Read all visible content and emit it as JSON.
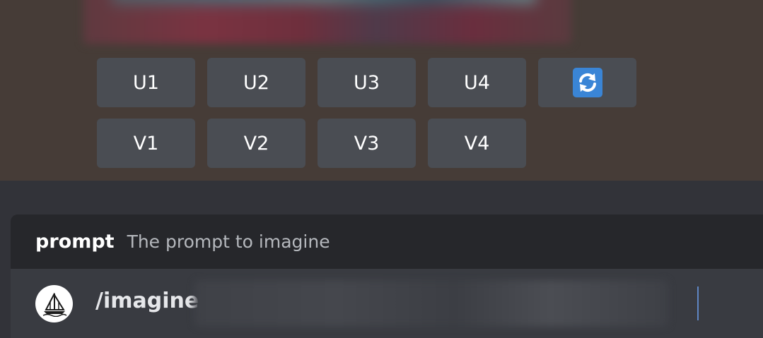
{
  "upscale_buttons": [
    {
      "label": "U1"
    },
    {
      "label": "U2"
    },
    {
      "label": "U3"
    },
    {
      "label": "U4"
    }
  ],
  "variation_buttons": [
    {
      "label": "V1"
    },
    {
      "label": "V2"
    },
    {
      "label": "V3"
    },
    {
      "label": "V4"
    }
  ],
  "reroll_button": {
    "icon": "refresh-icon",
    "icon_color": "#3a85d6"
  },
  "command_hint": {
    "option_name": "prompt",
    "option_description": "The prompt to imagine"
  },
  "message_input": {
    "command": "/imagine",
    "bot_avatar_icon": "sailboat-icon"
  }
}
